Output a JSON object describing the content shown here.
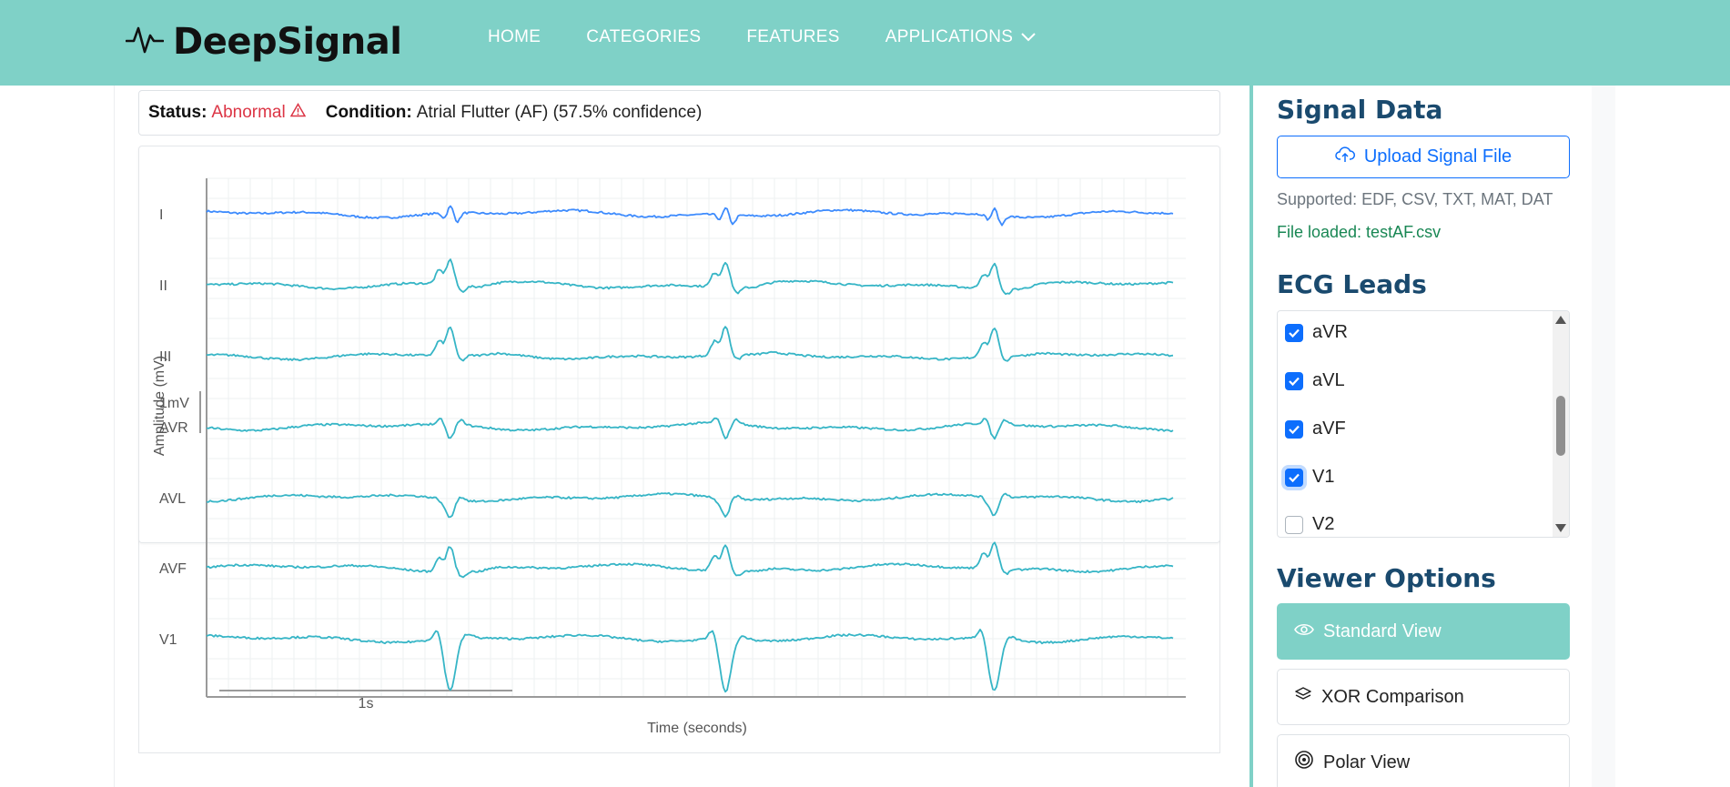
{
  "brand": {
    "name": "DeepSignal"
  },
  "nav": {
    "home": "HOME",
    "categories": "CATEGORIES",
    "features": "FEATURES",
    "applications": "APPLICATIONS"
  },
  "status": {
    "status_label": "Status:",
    "status_value": "Abnormal",
    "condition_label": "Condition:",
    "condition_value": "Atrial Flutter (AF) (57.5% confidence)"
  },
  "signal_data": {
    "title": "Signal Data",
    "upload_label": "Upload Signal File",
    "supported": "Supported: EDF, CSV, TXT, MAT, DAT",
    "file_loaded": "File loaded: testAF.csv"
  },
  "ecg_leads": {
    "title": "ECG Leads",
    "items": [
      {
        "label": "aVR",
        "checked": true
      },
      {
        "label": "aVL",
        "checked": true
      },
      {
        "label": "aVF",
        "checked": true
      },
      {
        "label": "V1",
        "checked": true
      },
      {
        "label": "V2",
        "checked": false
      }
    ]
  },
  "viewer_options": {
    "title": "Viewer Options",
    "standard": "Standard View",
    "xor": "XOR Comparison",
    "polar": "Polar View"
  },
  "colors": {
    "accent": "#7fd1c7",
    "lead_i": "#3d8bfd",
    "lead_other": "#36b5c6",
    "danger": "#dc3545",
    "primary": "#0d6efd",
    "success": "#198754"
  },
  "chart_data": {
    "type": "line",
    "xlabel": "Time (seconds)",
    "ylabel": "Amplitude (mV)",
    "scale_labels": {
      "time": "1s",
      "amplitude": "1mV"
    },
    "grid": true,
    "leads": [
      "I",
      "II",
      "III",
      "AVR",
      "AVL",
      "AVF",
      "V1"
    ],
    "beat_times": [
      2.52,
      5.37,
      8.15
    ],
    "x_range": [
      0,
      10
    ]
  }
}
